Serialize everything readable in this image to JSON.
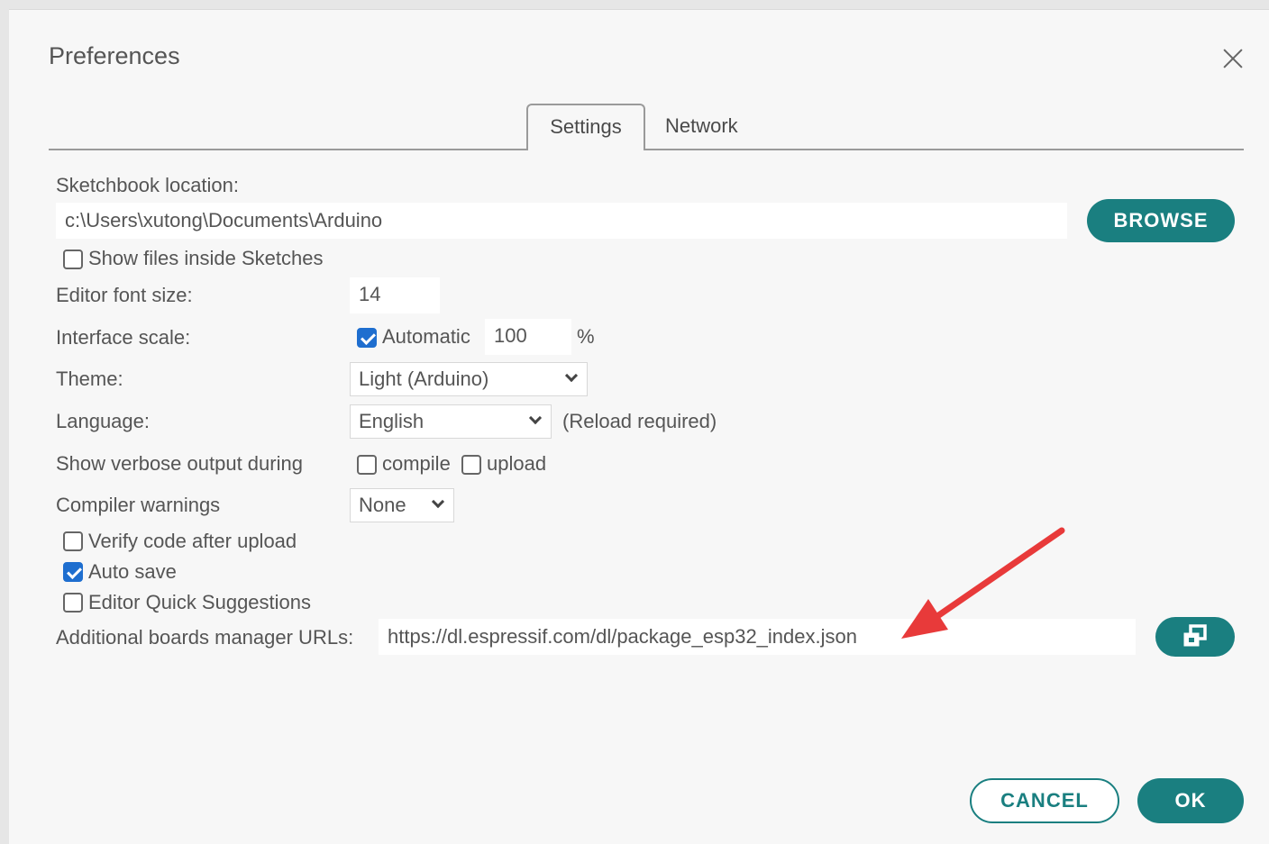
{
  "dialog": {
    "title": "Preferences",
    "tabs": [
      {
        "label": "Settings",
        "selected": true
      },
      {
        "label": "Network",
        "selected": false
      }
    ]
  },
  "sketchbook": {
    "label": "Sketchbook location:",
    "value": "c:\\Users\\xutong\\Documents\\Arduino",
    "browse_label": "BROWSE",
    "show_files_label": "Show files inside Sketches",
    "show_files_checked": false
  },
  "editor_font": {
    "label": "Editor font size:",
    "value": "14"
  },
  "interface_scale": {
    "label": "Interface scale:",
    "automatic_label": "Automatic",
    "automatic_checked": true,
    "value": "100",
    "unit": "%"
  },
  "theme": {
    "label": "Theme:",
    "selected": "Light (Arduino)"
  },
  "language": {
    "label": "Language:",
    "selected": "English",
    "note": "(Reload required)"
  },
  "verbose": {
    "label": "Show verbose output during",
    "compile_label": "compile",
    "compile_checked": false,
    "upload_label": "upload",
    "upload_checked": false
  },
  "compiler_warnings": {
    "label": "Compiler warnings",
    "selected": "None"
  },
  "options": [
    {
      "label": "Verify code after upload",
      "checked": false
    },
    {
      "label": "Auto save",
      "checked": true
    },
    {
      "label": "Editor Quick Suggestions",
      "checked": false
    }
  ],
  "boards_manager": {
    "label": "Additional boards manager URLs:",
    "value": "https://dl.espressif.com/dl/package_esp32_index.json",
    "icon": "window-restore-icon"
  },
  "footer": {
    "cancel_label": "CANCEL",
    "ok_label": "OK"
  },
  "colors": {
    "accent": "#1a7f80",
    "checkbox": "#1e6ecf",
    "annotation_arrow": "#e83a3a"
  }
}
